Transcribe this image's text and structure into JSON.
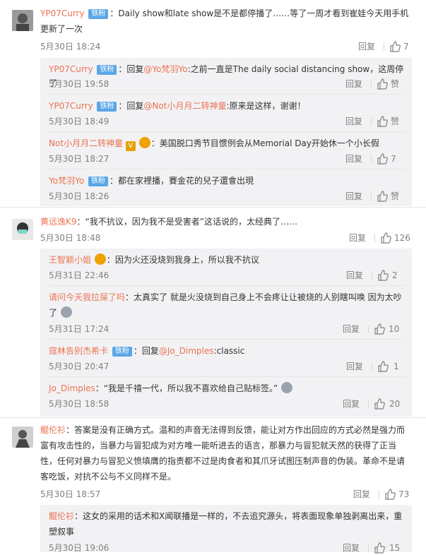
{
  "labels": {
    "reply": "回复",
    "like": "赞",
    "fan_badge": "铁粉"
  },
  "comments": [
    {
      "user": "YP07Curry",
      "badge": "铁粉",
      "text": "：Daily show和late show是不是都停播了……等了一周才看到崔娃今天用手机更新了一次",
      "time": "5月30日 18:24",
      "likes": "7",
      "replies": [
        {
          "user": "YP07Curry",
          "badge": "铁粉",
          "pre": "：回复",
          "mention": "@Yo梵羽Yo",
          "text": ":之前一直是The daily social distancing show，这周停了",
          "time": "5月30日 19:58",
          "likes": "赞"
        },
        {
          "user": "YP07Curry",
          "badge": "铁粉",
          "pre": "：回复",
          "mention": "@Not小月月二转神童",
          "text": ":原来是这样，谢谢！",
          "time": "5月30日 18:49",
          "likes": "赞"
        },
        {
          "user": "Not小月月二转神童",
          "badge": "",
          "pre": "",
          "mention": "",
          "text": "：美国脱口秀节目惯例会从Memorial Day开始休一个小长假",
          "time": "5月30日 18:27",
          "likes": "7"
        },
        {
          "user": "Yo梵羽Yo",
          "badge": "铁粉",
          "pre": "",
          "mention": "",
          "text": "：都在家裡播，賽金花的兒子還會出現",
          "time": "5月30日 18:26",
          "likes": "赞"
        }
      ]
    },
    {
      "user": "黄远逸K9",
      "badge": "",
      "text": "：“我不抗议，因为我不是受害者”这话说的，太经典了……",
      "time": "5月30日 18:48",
      "likes": "126",
      "replies": [
        {
          "user": "王智颖小姐",
          "badge": "",
          "pre": "",
          "mention": "",
          "text": "：因为火还没烧到我身上，所以我不抗议",
          "time": "5月31日 22:46",
          "likes": "2"
        },
        {
          "user": "请问今天我拉屎了吗",
          "badge": "",
          "pre": "",
          "mention": "",
          "text": "：太真实了 就是火没烧到自己身上不会疼让让被烧的人别瞎叫唤 因为太吵了",
          "time": "5月31日 17:24",
          "likes": "10"
        },
        {
          "user": "寇林告别杰希卡",
          "badge": "铁粉",
          "pre": "：回复",
          "mention": "@Jo_Dimples",
          "text": ":classic",
          "time": "5月30日 20:47",
          "likes": "1"
        },
        {
          "user": "Jo_Dimples",
          "badge": "",
          "pre": "",
          "mention": "",
          "text": "：“我是千禧一代，所以我不喜欢给自己贴标签。”",
          "time": "5月30日 18:58",
          "likes": "20"
        }
      ]
    },
    {
      "user": "鲲伦衫",
      "badge": "",
      "text": "：答案是没有正确方式。温和的声音无法得到反馈，能让对方作出回应的方式必然是强力而富有攻击性的，当暴力与冒犯成为对方唯一能听进去的语言，那暴力与冒犯就天然的获得了正当性，任何对暴力与冒犯义愤填膺的指责都不过是肉食者和其爪牙试图压制声音的伪装。革命不是请客吃饭，对抗不公与不义同样不是。",
      "time": "5月30日 18:57",
      "likes": "73",
      "replies": [
        {
          "user": "鲲伦衫",
          "badge": "",
          "pre": "",
          "mention": "",
          "text": "：这女的采用的话术和X闻联播是一样的，不去追究源头，将表面现象单独剥离出来，重塑叙事",
          "time": "5月30日 19:06",
          "likes": "15"
        }
      ]
    }
  ],
  "colors": {
    "link": "#eb7350",
    "badge": "#5aa7e6",
    "subbg": "#f2f2f5"
  }
}
